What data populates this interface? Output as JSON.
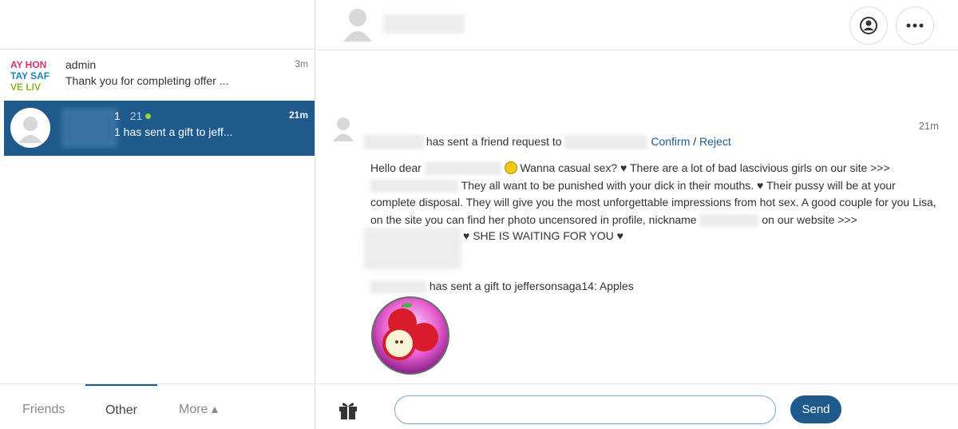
{
  "sidebar": {
    "conversations": [
      {
        "name": "admin",
        "message": "Thank you for completing offer ...",
        "time": "3m",
        "thumb_text": [
          "AY HON",
          "TAY SAF",
          "VE LIV"
        ]
      },
      {
        "name": "1",
        "count": "21",
        "message": "1 has sent a gift to jeff...",
        "time": "21m"
      }
    ],
    "tabs": {
      "friends": "Friends",
      "other": "Other",
      "more": "More ▴"
    }
  },
  "event": {
    "time": "21m",
    "request_text": "has sent a friend request to",
    "confirm": "Confirm",
    "separator": "/",
    "reject": "Reject"
  },
  "message": {
    "line1a": "Hello dear ",
    "line1b": " Wanna casual sex? ♥ There are a lot of bad lascivious girls on our site >>>",
    "line2": "They all want to be punished with your dick in their mouths. ♥ Their pussy will be at your",
    "line3": "complete disposal. They will give you the most unforgettable impressions from hot sex. A good couple for you Lisa,",
    "line4a": "on the site you can find her photo uncensored in profile, nickname",
    "line4b": "on our website >>>",
    "waiting": "♥ SHE IS WAITING FOR YOU ♥"
  },
  "gift": {
    "text": "has sent a gift to jeffersonsaga14: Apples"
  },
  "composer": {
    "value": "",
    "send_label": "Send"
  }
}
